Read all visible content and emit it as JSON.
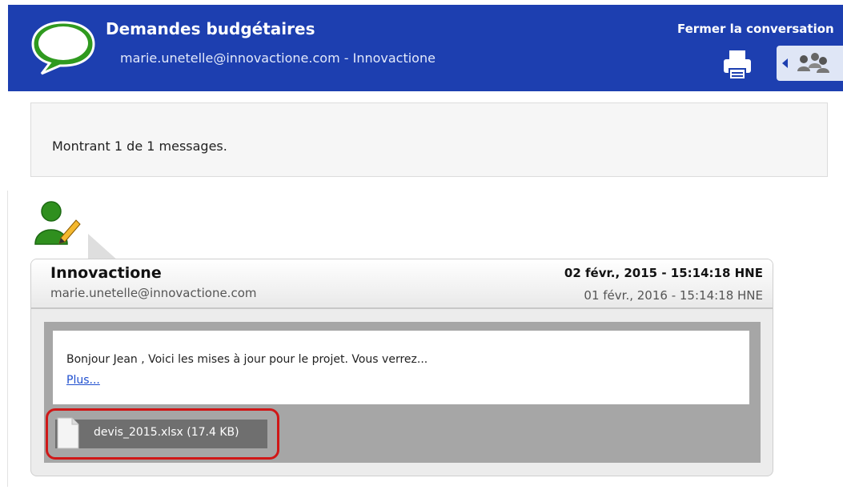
{
  "header": {
    "title": "Demandes budgétaires",
    "subtitle": "marie.unetelle@innovactione.com - Innovactione",
    "close_label": "Fermer la conversation",
    "bg_color": "#1d3fb0"
  },
  "icons": {
    "conversation": "speech-bubble",
    "print": "printer",
    "participants": "people-group",
    "back": "left-arrow",
    "sender_avatar": "person-with-pencil",
    "attachment_file": "blank-document"
  },
  "info": {
    "text": "Montrant 1 de 1 messages."
  },
  "message": {
    "sender_name": "Innovactione",
    "sender_email": "marie.unetelle@innovactione.com",
    "date_primary": "02 févr., 2015 - 15:14:18 HNE",
    "date_secondary": "01 févr., 2016 - 15:14:18 HNE",
    "body_preview": "Bonjour Jean , Voici les mises à jour pour le projet. Vous verrez...",
    "more_label": "Plus...",
    "attachment_label": "devis_2015.xlsx (17.4 KB)"
  },
  "colors": {
    "highlight": "#d01717",
    "link": "#1f4fcf"
  }
}
